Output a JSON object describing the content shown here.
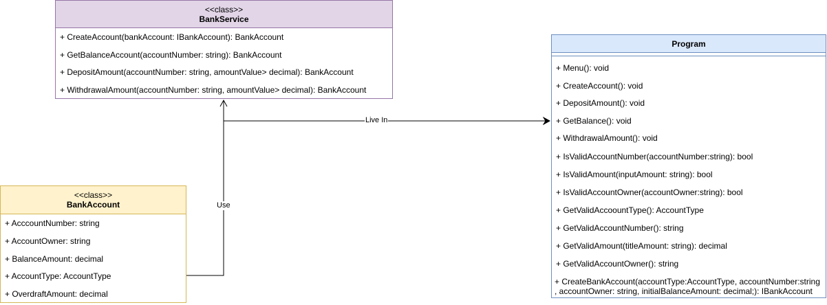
{
  "classes": {
    "bank_service": {
      "stereotype": "<<class>>",
      "name": "BankService",
      "members": [
        "+ CreateAccount(bankAccount: IBankAccount): BankAccount",
        "+ GetBalanceAccount(accountNumber: string): BankAccount",
        "+ DepositAmount(accountNumber: string, amountValue> decimal): BankAccount",
        "+ WithdrawalAmount(accountNumber: string, amountValue> decimal): BankAccount"
      ]
    },
    "bank_account": {
      "stereotype": "<<class>>",
      "name": "BankAccount",
      "members": [
        "+ AcccountNumber: string",
        "+ AccountOwner: string",
        "+ BalanceAmount: decimal",
        "+ AccountType: AccountType",
        "+ OverdraftAmount: decimal"
      ]
    },
    "program": {
      "name": "Program",
      "members": [
        "+ Menu(): void",
        "+ CreateAccount(): void",
        "+ DepositAmount(): void",
        "+ GetBalance(): void",
        "+ WithdrawalAmount(): void",
        "+ IsValidAccountNumber(accountNumber:string): bool",
        "+ IsValidAmount(inputAmount: string): bool",
        "+ IsValidAccountOwner(accountOwner:string): bool",
        "+ GetValidAccoountType(): AccountType",
        "+ GetValidAccountNumber(): string",
        "+ GetValidAmount(titleAmount: string): decimal",
        "+ GetValidAccountOwner(): string",
        "+ CreateBankAccount(accountType:AccountType, accountNumber:string , accountOwner: string, initialBalanceAmount: decimal;): IBankAccount"
      ]
    }
  },
  "edges": {
    "use_label": "Use",
    "live_in_label": "Live In"
  },
  "colors": {
    "bank_service_fill": "#e1d5e7",
    "bank_service_stroke": "#9673a6",
    "bank_account_fill": "#fff2cc",
    "bank_account_stroke": "#d6b656",
    "program_fill": "#dae8fc",
    "program_stroke": "#6c8ebf"
  }
}
